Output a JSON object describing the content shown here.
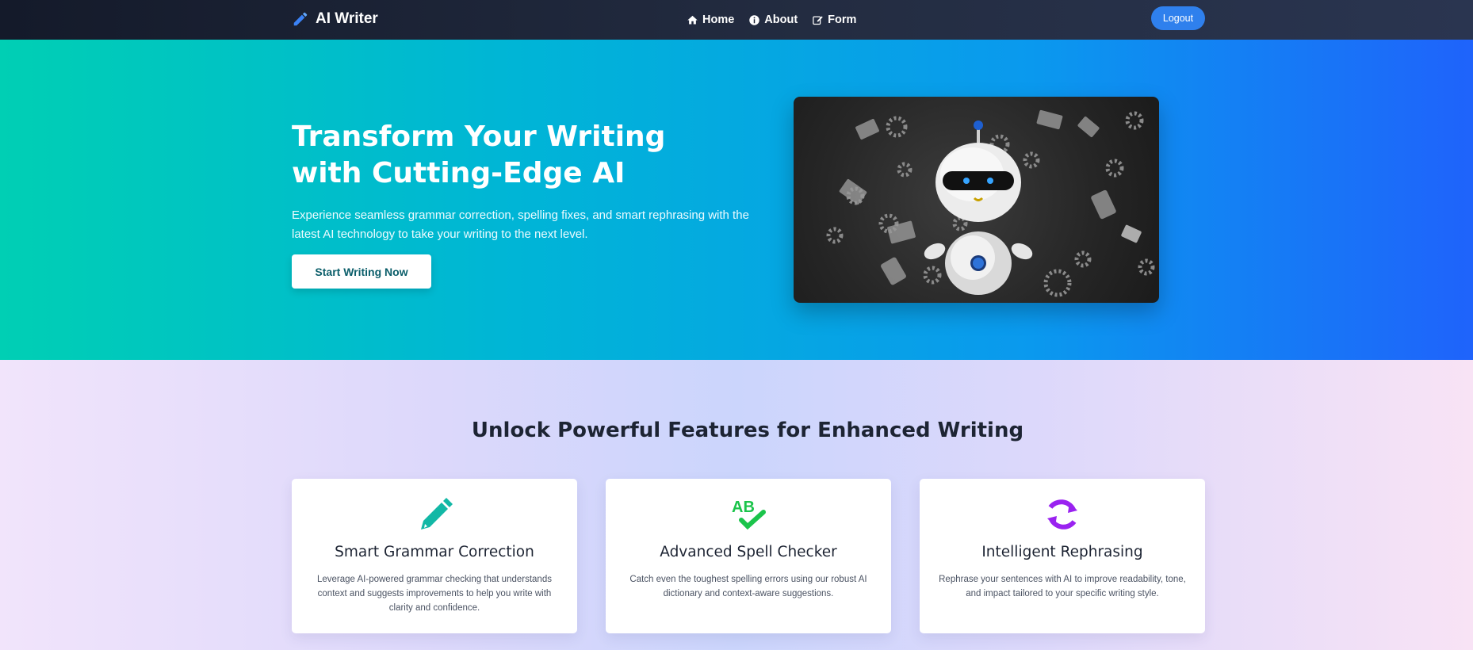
{
  "nav": {
    "brand": "AI Writer",
    "links": [
      {
        "label": "Home",
        "icon": "home-icon"
      },
      {
        "label": "About",
        "icon": "info-icon"
      },
      {
        "label": "Form",
        "icon": "edit-icon"
      }
    ],
    "logout": "Logout"
  },
  "hero": {
    "title": "Transform Your Writing with Cutting-Edge AI",
    "subtitle": "Experience seamless grammar correction, spelling fixes, and smart rephrasing with the latest AI technology to take your writing to the next level.",
    "cta": "Start Writing Now"
  },
  "features": {
    "title": "Unlock Powerful Features for Enhanced Writing",
    "cards": [
      {
        "icon": "pencil-icon",
        "icon_color": "#12b8a6",
        "title": "Smart Grammar Correction",
        "text": "Leverage AI-powered grammar checking that understands context and suggests improvements to help you write with clarity and confidence."
      },
      {
        "icon": "spell-check-icon",
        "icon_color": "#1bc44b",
        "title": "Advanced Spell Checker",
        "text": "Catch even the toughest spelling errors using our robust AI dictionary and context-aware suggestions."
      },
      {
        "icon": "sync-icon",
        "icon_color": "#9a22f0",
        "title": "Intelligent Rephrasing",
        "text": "Rephrase your sentences with AI to improve readability, tone, and impact tailored to your specific writing style."
      }
    ]
  },
  "colors": {
    "nav_bg": "#1b2234",
    "accent": "#2f80ed",
    "hero_start": "#00cfb4",
    "hero_end": "#1f63fb"
  }
}
